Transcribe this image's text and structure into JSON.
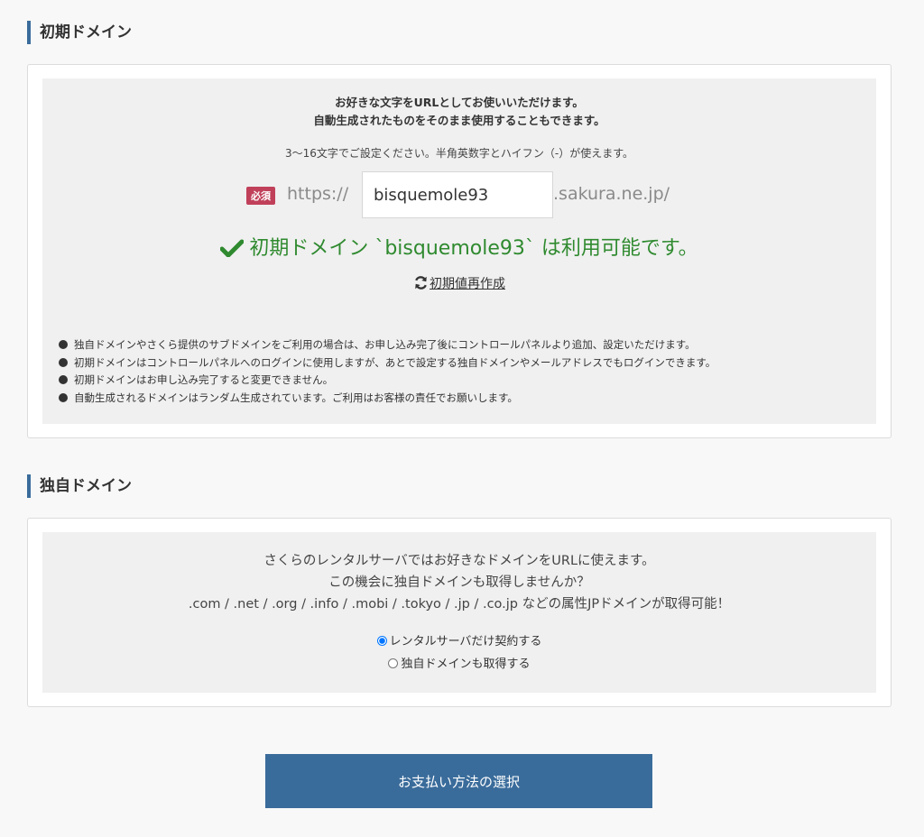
{
  "initial_domain": {
    "heading": "初期ドメイン",
    "lead_line1": "お好きな文字をURLとしてお使いいただけます。",
    "lead_line2": "自動生成されたものをそのまま使用することもできます。",
    "hint": "3〜16文字でご設定ください。半角英数字とハイフン（-）が使えます。",
    "required_badge": "必須",
    "prefix": "https://",
    "input_value": "bisquemole93",
    "suffix": ".sakura.ne.jp/",
    "availability_message": "初期ドメイン `bisquemole93` は利用可能です。",
    "regenerate_label": "初期値再作成",
    "notes": [
      "独自ドメインやさくら提供のサブドメインをご利用の場合は、お申し込み完了後にコントロールパネルより追加、設定いただけます。",
      "初期ドメインはコントロールパネルへのログインに使用しますが、あとで設定する独自ドメインやメールアドレスでもログインできます。",
      "初期ドメインはお申し込み完了すると変更できません。",
      "自動生成されるドメインはランダム生成されています。ご利用はお客様の責任でお願いします。"
    ]
  },
  "custom_domain": {
    "heading": "独自ドメイン",
    "promo_line1": "さくらのレンタルサーバではお好きなドメインをURLに使えます。",
    "promo_line2": "この機会に独自ドメインも取得しませんか？",
    "promo_line3": ".com / .net / .org / .info / .mobi / .tokyo / .jp / .co.jp などの属性JPドメインが取得可能！",
    "options": [
      {
        "label": "レンタルサーバだけ契約する",
        "selected": true
      },
      {
        "label": "独自ドメインも取得する",
        "selected": false
      }
    ]
  },
  "submit_button_label": "お支払い方法の選択",
  "colors": {
    "accent": "#3a6c9b",
    "success": "#2f8a2f",
    "required_badge": "#c0405a"
  },
  "icons": {
    "availability": "check-icon",
    "regenerate": "refresh-icon",
    "note_bullet": "bullet-dot-icon"
  }
}
